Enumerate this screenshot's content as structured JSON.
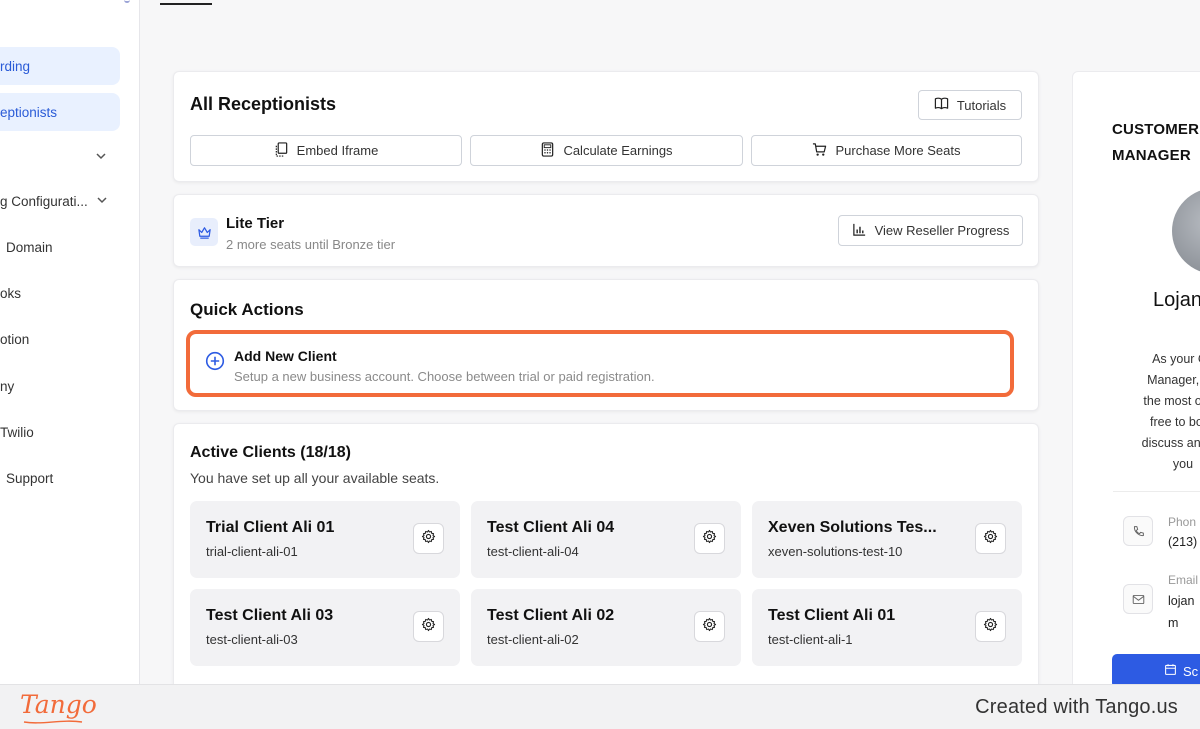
{
  "sidebar": {
    "items": [
      {
        "label": "rding",
        "active": true,
        "chevron": false
      },
      {
        "label": "eptionists",
        "active": true,
        "chevron": false
      },
      {
        "label": "",
        "active": false,
        "chevron": true
      },
      {
        "label": "g Configurati...",
        "active": false,
        "chevron": true
      },
      {
        "label": "Domain",
        "active": false,
        "chevron": false
      },
      {
        "label": "oks",
        "active": false,
        "chevron": false
      },
      {
        "label": "otion",
        "active": false,
        "chevron": false
      },
      {
        "label": "ny",
        "active": false,
        "chevron": false
      },
      {
        "label": "Twilio",
        "active": false,
        "chevron": false
      },
      {
        "label": "Support",
        "active": false,
        "chevron": false
      }
    ]
  },
  "receptionists": {
    "title": "All Receptionists",
    "tutorials_label": "Tutorials",
    "embed_label": "Embed Iframe",
    "calculate_label": "Calculate Earnings",
    "purchase_label": "Purchase More Seats"
  },
  "tier": {
    "name": "Lite Tier",
    "subtitle": "2 more seats until Bronze tier",
    "progress_label": "View Reseller Progress"
  },
  "quick_actions": {
    "title": "Quick Actions",
    "add_client_title": "Add New Client",
    "add_client_subtitle": "Setup a new business account. Choose between trial or paid registration."
  },
  "clients": {
    "title": "Active Clients (18/18)",
    "subtitle": "You have set up all your available seats.",
    "items": [
      {
        "name": "Trial Client Ali 01",
        "slug": "trial-client-ali-01"
      },
      {
        "name": "Test Client Ali 04",
        "slug": "test-client-ali-04"
      },
      {
        "name": "Xeven Solutions Tes...",
        "slug": "xeven-solutions-test-10"
      },
      {
        "name": "Test Client Ali 03",
        "slug": "test-client-ali-03"
      },
      {
        "name": "Test Client Ali 02",
        "slug": "test-client-ali-02"
      },
      {
        "name": "Test Client Ali 01",
        "slug": "test-client-ali-1"
      }
    ]
  },
  "manager": {
    "title_line1": "CUSTOMER",
    "title_line2": "MANAGER",
    "name": "Lojan",
    "desc_lines": [
      "As your Cu",
      "Manager, I'm",
      "the most out o",
      "free to book",
      "discuss any qu",
      "you"
    ],
    "phone_label": "Phon",
    "phone_value": "(213)",
    "email_label": "Email",
    "email_value_line1": "lojan",
    "email_value_line2": "m",
    "schedule_label": "Sc"
  },
  "footer": {
    "logo": "Tango",
    "credit": "Created with Tango.us"
  },
  "colors": {
    "accent": "#2d5be3",
    "highlight": "#f26b3a",
    "active_nav_bg": "#e9f1ff"
  }
}
